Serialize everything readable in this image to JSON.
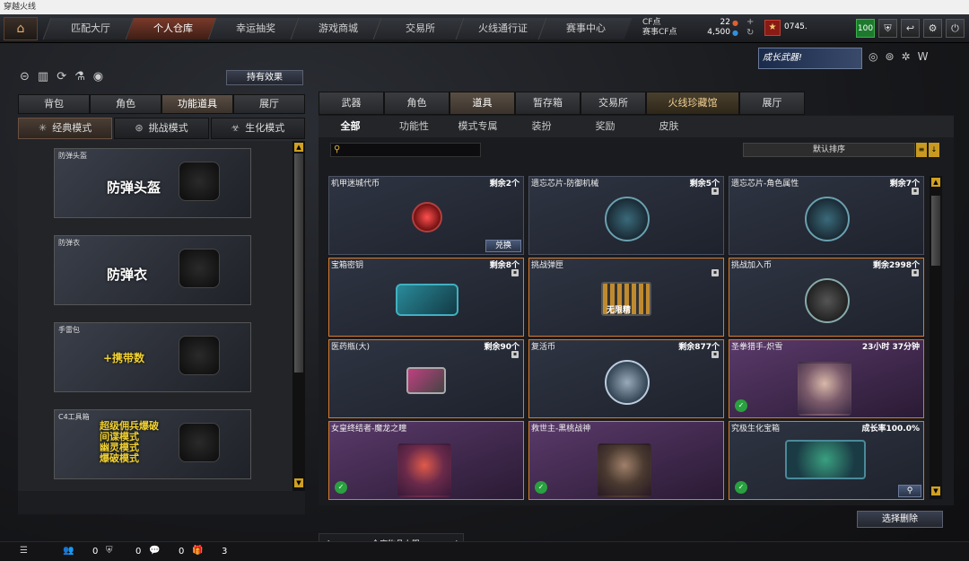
{
  "window": {
    "title": "穿越火线"
  },
  "nav": {
    "tabs": [
      "匹配大厅",
      "个人仓库",
      "幸运抽奖",
      "游戏商城",
      "交易所",
      "火线通行证",
      "赛事中心"
    ],
    "active": 1
  },
  "currency": {
    "cf_label": "CF点",
    "cf_value": "22",
    "event_label": "赛事CF点",
    "event_value": "4,500"
  },
  "user": {
    "name": "0745.",
    "badge_value": "100"
  },
  "banner": {
    "text": "成长武器!"
  },
  "left": {
    "hold_button": "持有效果",
    "tabs": [
      "背包",
      "角色",
      "功能道具",
      "展厅"
    ],
    "active_tab": 2,
    "mode_tabs": [
      "经典模式",
      "挑战模式",
      "生化模式"
    ],
    "active_mode": 0,
    "gear": [
      {
        "label": "防弹头盔",
        "text": "防弹头盔"
      },
      {
        "label": "防弹衣",
        "text": "防弹衣"
      },
      {
        "label": "手雷包",
        "text": "+携带数"
      },
      {
        "label": "C4工具箱",
        "text": "超级佣兵爆破\n间谍模式\n幽灵模式\n爆破模式"
      }
    ]
  },
  "right": {
    "tabs": [
      "武器",
      "角色",
      "道具",
      "暂存箱",
      "交易所",
      "火线珍藏馆",
      "展厅"
    ],
    "active_tab": 2,
    "sub_tabs": [
      "全部",
      "功能性",
      "模式专属",
      "装扮",
      "奖励",
      "皮肤"
    ],
    "active_sub": 0,
    "search": {
      "placeholder": ""
    },
    "sort_label": "默认排序",
    "items": [
      {
        "name": "机甲迷城代币",
        "remain": "剩余2个",
        "action": "兑换"
      },
      {
        "name": "遗忘芯片-防御机械",
        "remain": "剩余5个"
      },
      {
        "name": "遗忘芯片-角色属性",
        "remain": "剩余7个"
      },
      {
        "name": "宝箱密钥",
        "remain": "剩余8个"
      },
      {
        "name": "挑战弹匣",
        "remain": "",
        "text": "无限精"
      },
      {
        "name": "挑战加入币",
        "remain": "剩余2998个"
      },
      {
        "name": "医药瓶(大)",
        "remain": "剩余90个"
      },
      {
        "name": "复活币",
        "remain": "剩余877个"
      },
      {
        "name": "圣拳猎手-炽雪",
        "remain": "23小时 37分钟"
      },
      {
        "name": "女皇终结者-魔龙之瞳",
        "remain": ""
      },
      {
        "name": "救世主-黑桃战神",
        "remain": ""
      },
      {
        "name": "究极生化宝箱",
        "remain": "成长率100.0%"
      }
    ],
    "delete_button": "选择删除",
    "inventory_limit": "仓库物品上限"
  },
  "status": {
    "v1": "0",
    "v2": "0",
    "v3": "0",
    "v4": "3"
  }
}
